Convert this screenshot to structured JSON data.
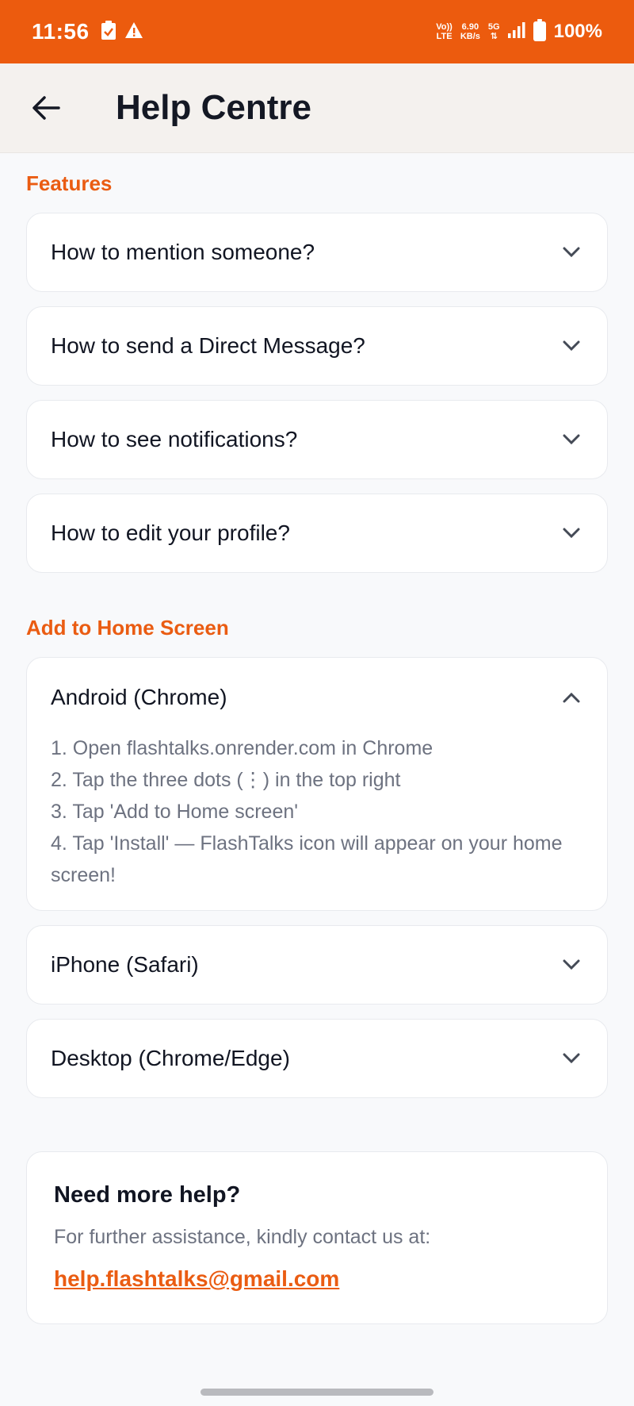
{
  "status_bar": {
    "time": "11:56",
    "lte_label_top": "Vo))",
    "lte_label_bottom": "LTE",
    "speed_value": "6.90",
    "speed_unit": "KB/s",
    "network": "5G",
    "battery": "100%",
    "icons": [
      "clipboard-check-icon",
      "warning-icon",
      "signal-icon",
      "battery-icon"
    ]
  },
  "app_bar": {
    "back_icon": "arrow-left-icon",
    "title": "Help Centre"
  },
  "sections": {
    "features": {
      "title": "Features",
      "items": [
        {
          "question": "How to mention someone?",
          "expanded": false
        },
        {
          "question": "How to send a Direct Message?",
          "expanded": false
        },
        {
          "question": "How to see notifications?",
          "expanded": false
        },
        {
          "question": "How to edit your profile?",
          "expanded": false
        }
      ]
    },
    "home_screen": {
      "title": "Add to Home Screen",
      "items": [
        {
          "question": "Android (Chrome)",
          "expanded": true,
          "steps": [
            "1. Open flashtalks.onrender.com in Chrome",
            "2. Tap the three dots (⋮) in the top right",
            "3. Tap 'Add to Home screen'",
            "4. Tap 'Install' — FlashTalks icon will appear on your home screen!"
          ]
        },
        {
          "question": "iPhone (Safari)",
          "expanded": false
        },
        {
          "question": "Desktop (Chrome/Edge)",
          "expanded": false
        }
      ]
    }
  },
  "help": {
    "title": "Need more help?",
    "text": "For further assistance, kindly contact us at:",
    "email": "help.flashtalks@gmail.com"
  },
  "colors": {
    "accent": "#ec5b0e",
    "app_bar_bg": "#f4f1ee",
    "page_bg": "#f8f9fb",
    "muted_text": "#6d7280"
  }
}
